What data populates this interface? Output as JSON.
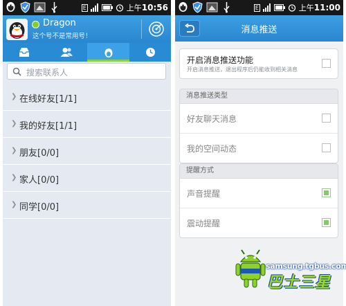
{
  "left_screen": {
    "status_time_prefix": "上午",
    "status_time": "10:56",
    "user": {
      "name": "Dragon",
      "signature": "这个号不是常用号！"
    },
    "search_placeholder": "搜索联系人",
    "groups": [
      {
        "label": "在线好友[1/1]"
      },
      {
        "label": "我的好友[1/1]"
      },
      {
        "label": "朋友[0/0]"
      },
      {
        "label": "家人[0/0]"
      },
      {
        "label": "同学[0/0]"
      }
    ],
    "active_tab": 2
  },
  "right_screen": {
    "status_time_prefix": "上午",
    "status_time": "11:00",
    "title": "消息推送",
    "master": {
      "label": "开启消息推送功能",
      "desc": "开启消息推送，退出程序后仍能收到相关消息",
      "checked": false
    },
    "section_types": {
      "header": "消息推送类型",
      "items": [
        {
          "label": "好友聊天消息",
          "checked": false
        },
        {
          "label": "我的空间动态",
          "checked": false
        }
      ]
    },
    "section_alert": {
      "header": "提醒方式",
      "items": [
        {
          "label": "声音提醒",
          "checked": true
        },
        {
          "label": "震动提醒",
          "checked": true
        }
      ]
    }
  },
  "watermark": {
    "line1": "samsung.tgbus.com",
    "line2": "巴士三星"
  },
  "colors": {
    "header_blue": "#2986cf",
    "tab_active_bar": "#8ed044",
    "online_dot": "#7ed321"
  }
}
